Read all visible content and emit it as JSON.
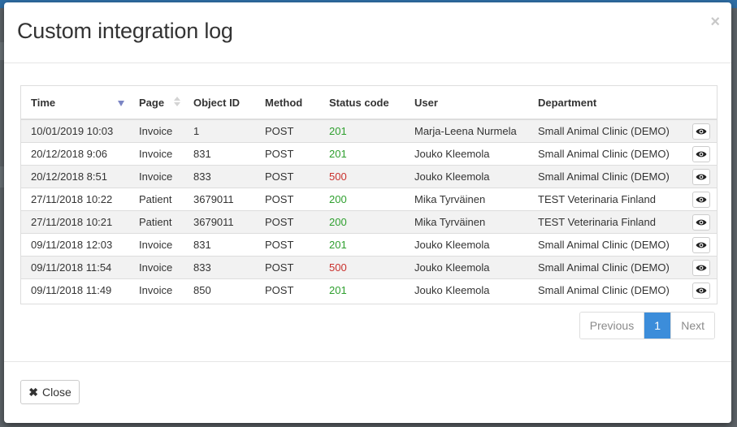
{
  "modal": {
    "title": "Custom integration log",
    "close_glyph": "×"
  },
  "table": {
    "columns": [
      "Time",
      "Page",
      "Object ID",
      "Method",
      "Status code",
      "User",
      "Department"
    ],
    "sort": {
      "column": "Time",
      "direction": "desc"
    },
    "rows": [
      {
        "time": "10/01/2019 10:03",
        "page": "Invoice",
        "object_id": "1",
        "method": "POST",
        "status": "201",
        "user": "Marja-Leena Nurmela",
        "department": "Small Animal Clinic (DEMO)"
      },
      {
        "time": "20/12/2018 9:06",
        "page": "Invoice",
        "object_id": "831",
        "method": "POST",
        "status": "201",
        "user": "Jouko Kleemola",
        "department": "Small Animal Clinic (DEMO)"
      },
      {
        "time": "20/12/2018 8:51",
        "page": "Invoice",
        "object_id": "833",
        "method": "POST",
        "status": "500",
        "user": "Jouko Kleemola",
        "department": "Small Animal Clinic (DEMO)"
      },
      {
        "time": "27/11/2018 10:22",
        "page": "Patient",
        "object_id": "3679011",
        "method": "POST",
        "status": "200",
        "user": "Mika Tyrväinen",
        "department": "TEST Veterinaria Finland"
      },
      {
        "time": "27/11/2018 10:21",
        "page": "Patient",
        "object_id": "3679011",
        "method": "POST",
        "status": "200",
        "user": "Mika Tyrväinen",
        "department": "TEST Veterinaria Finland"
      },
      {
        "time": "09/11/2018 12:03",
        "page": "Invoice",
        "object_id": "831",
        "method": "POST",
        "status": "201",
        "user": "Jouko Kleemola",
        "department": "Small Animal Clinic (DEMO)"
      },
      {
        "time": "09/11/2018 11:54",
        "page": "Invoice",
        "object_id": "833",
        "method": "POST",
        "status": "500",
        "user": "Jouko Kleemola",
        "department": "Small Animal Clinic (DEMO)"
      },
      {
        "time": "09/11/2018 11:49",
        "page": "Invoice",
        "object_id": "850",
        "method": "POST",
        "status": "201",
        "user": "Jouko Kleemola",
        "department": "Small Animal Clinic (DEMO)"
      }
    ],
    "row_action_icon": "eye-icon"
  },
  "pagination": {
    "previous": "Previous",
    "current": "1",
    "next": "Next"
  },
  "footer": {
    "close_label": "Close",
    "close_icon": "times-icon"
  },
  "colors": {
    "status_success": "#2e9f2e",
    "status_error": "#c9302c",
    "pagination_active": "#3c8dda",
    "sort_active": "#7b85c4"
  }
}
